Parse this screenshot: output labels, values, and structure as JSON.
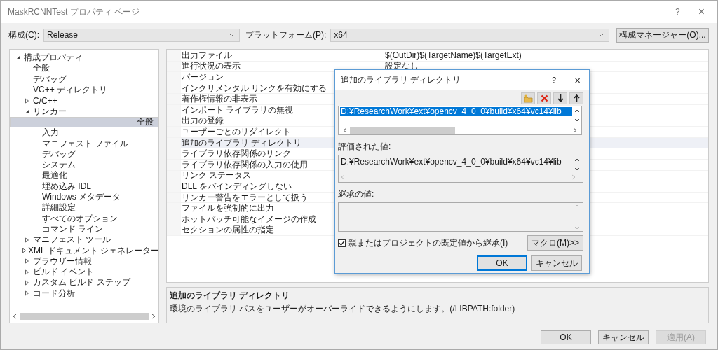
{
  "window": {
    "title": "MaskRCNNTest プロパティ ページ",
    "help": "?",
    "close": "×"
  },
  "config": {
    "config_label": "構成(C):",
    "config_value": "Release",
    "platform_label": "プラットフォーム(P):",
    "platform_value": "x64",
    "manager_button": "構成マネージャー(O)..."
  },
  "tree": {
    "items": [
      {
        "label": "構成プロパティ",
        "selected": false,
        "expanded": true,
        "children": [
          {
            "label": "全般",
            "selected": false
          },
          {
            "label": "デバッグ",
            "selected": false
          },
          {
            "label": "VC++ ディレクトリ",
            "selected": false
          },
          {
            "label": "C/C++",
            "selected": false,
            "expanded": false
          },
          {
            "label": "リンカー",
            "selected": false,
            "expanded": true,
            "children": [
              {
                "label": "全般",
                "selected": true
              },
              {
                "label": "入力",
                "selected": false
              },
              {
                "label": "マニフェスト ファイル",
                "selected": false
              },
              {
                "label": "デバッグ",
                "selected": false
              },
              {
                "label": "システム",
                "selected": false
              },
              {
                "label": "最適化",
                "selected": false
              },
              {
                "label": "埋め込み IDL",
                "selected": false
              },
              {
                "label": "Windows メタデータ",
                "selected": false
              },
              {
                "label": "詳細設定",
                "selected": false
              },
              {
                "label": "すべてのオプション",
                "selected": false
              },
              {
                "label": "コマンド ライン",
                "selected": false
              }
            ]
          },
          {
            "label": "マニフェスト ツール",
            "selected": false,
            "expanded": false
          },
          {
            "label": "XML ドキュメント ジェネレーター",
            "selected": false,
            "expanded": false
          },
          {
            "label": "ブラウザー情報",
            "selected": false,
            "expanded": false
          },
          {
            "label": "ビルド イベント",
            "selected": false,
            "expanded": false
          },
          {
            "label": "カスタム ビルド ステップ",
            "selected": false,
            "expanded": false
          },
          {
            "label": "コード分析",
            "selected": false,
            "expanded": false
          }
        ]
      }
    ]
  },
  "properties": [
    {
      "name": "出力ファイル",
      "value": "$(OutDir)$(TargetName)$(TargetExt)",
      "selected": false
    },
    {
      "name": "進行状況の表示",
      "value": "設定なし",
      "selected": false
    },
    {
      "name": "バージョン",
      "selected": false
    },
    {
      "name": "インクリメンタル リンクを有効にする",
      "selected": false
    },
    {
      "name": "著作権情報の非表示",
      "selected": false
    },
    {
      "name": "インポート ライブラリの無視",
      "selected": false
    },
    {
      "name": "出力の登録",
      "selected": false
    },
    {
      "name": "ユーザーごとのリダイレクト",
      "selected": false
    },
    {
      "name": "追加のライブラリ ディレクトリ",
      "selected": true
    },
    {
      "name": "ライブラリ依存関係のリンク",
      "selected": false
    },
    {
      "name": "ライブラリ依存関係の入力の使用",
      "selected": false
    },
    {
      "name": "リンク ステータス",
      "selected": false
    },
    {
      "name": "DLL をバインディングしない",
      "selected": false
    },
    {
      "name": "リンカー警告をエラーとして扱う",
      "selected": false
    },
    {
      "name": "ファイルを強制的に出力",
      "selected": false
    },
    {
      "name": "ホットパッチ可能なイメージの作成",
      "selected": false
    },
    {
      "name": "セクションの属性の指定",
      "selected": false
    }
  ],
  "description": {
    "title": "追加のライブラリ ディレクトリ",
    "text": "環境のライブラリ パスをユーザーがオーバーライドできるようにします。(/LIBPATH:folder)"
  },
  "dialog": {
    "title": "追加のライブラリ ディレクトリ",
    "help": "?",
    "close": "×",
    "entries": [
      {
        "text": "D:¥ResearchWork¥ext¥opencv_4_0_0¥build¥x64¥vc14¥lib",
        "selected": true
      }
    ],
    "evaluated_label": "評価された値:",
    "evaluated_value": "D:¥ResearchWork¥ext¥opencv_4_0_0¥build¥x64¥vc14¥lib",
    "inherited_label": "継承の値:",
    "inherit_checkbox": {
      "label": "親またはプロジェクトの既定値から継承(I)",
      "checked": true
    },
    "macro_button": "マクロ(M)>>",
    "ok_button": "OK",
    "cancel_button": "キャンセル"
  },
  "buttons": [
    {
      "label": "OK",
      "disabled": false
    },
    {
      "label": "キャンセル",
      "disabled": false
    },
    {
      "label": "適用(A)",
      "disabled": true
    }
  ]
}
